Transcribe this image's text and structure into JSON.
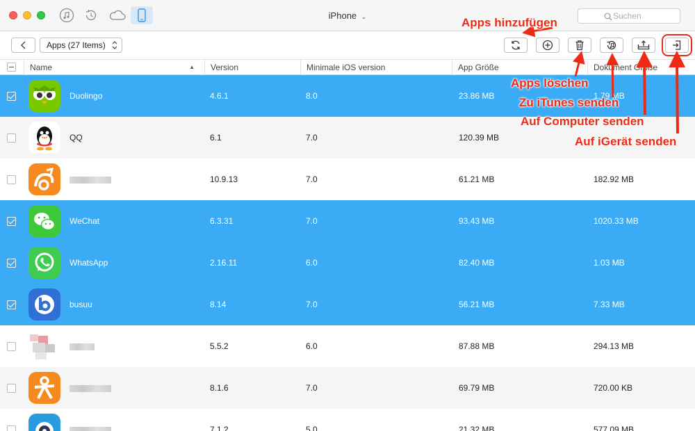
{
  "window": {
    "title": "iPhone"
  },
  "search": {
    "placeholder": "Suchen"
  },
  "toolbar": {
    "category_label": "Apps (27 Items)"
  },
  "columns": [
    "Name",
    "Version",
    "Minimale iOS version",
    "App Größe",
    "Dokument Größe"
  ],
  "rows": [
    {
      "name": "Duolingo",
      "version": "4.6.1",
      "min_ios": "8.0",
      "app_size": "23.86 MB",
      "doc_size": "1.79 MB",
      "selected": true,
      "icon": "duolingo-icon"
    },
    {
      "name": "QQ",
      "version": "6.1",
      "min_ios": "7.0",
      "app_size": "120.39 MB",
      "doc_size": "",
      "selected": false,
      "icon": "qq-icon"
    },
    {
      "name": "",
      "version": "10.9.13",
      "min_ios": "7.0",
      "app_size": "61.21 MB",
      "doc_size": "182.92 MB",
      "selected": false,
      "icon": "uc-browser-icon"
    },
    {
      "name": "WeChat",
      "version": "6.3.31",
      "min_ios": "7.0",
      "app_size": "93.43 MB",
      "doc_size": "1020.33 MB",
      "selected": true,
      "icon": "wechat-icon"
    },
    {
      "name": "WhatsApp",
      "version": "2.16.11",
      "min_ios": "6.0",
      "app_size": "82.40 MB",
      "doc_size": "1.03 MB",
      "selected": true,
      "icon": "whatsapp-icon"
    },
    {
      "name": "busuu",
      "version": "8.14",
      "min_ios": "7.0",
      "app_size": "56.21 MB",
      "doc_size": "7.33 MB",
      "selected": true,
      "icon": "busuu-icon"
    },
    {
      "name": "",
      "version": "5.5.2",
      "min_ios": "6.0",
      "app_size": "87.88 MB",
      "doc_size": "294.13 MB",
      "selected": false,
      "icon": "blurred-app-icon"
    },
    {
      "name": "",
      "version": "8.1.6",
      "min_ios": "7.0",
      "app_size": "69.79 MB",
      "doc_size": "720.00 KB",
      "selected": false,
      "icon": "orange-person-app-icon"
    },
    {
      "name": "",
      "version": "7.1.2",
      "min_ios": "5.0",
      "app_size": "21.32 MB",
      "doc_size": "577.09 MB",
      "selected": false,
      "icon": "blue-app-icon"
    }
  ],
  "annotations": {
    "add": "Apps hinzufügen",
    "delete": "Apps löschen",
    "itunes": "Zu iTunes senden",
    "computer": "Auf Computer senden",
    "device": "Auf iGerät senden"
  },
  "colors": {
    "selection": "#3aabf4",
    "annotation": "#ee2a14"
  }
}
